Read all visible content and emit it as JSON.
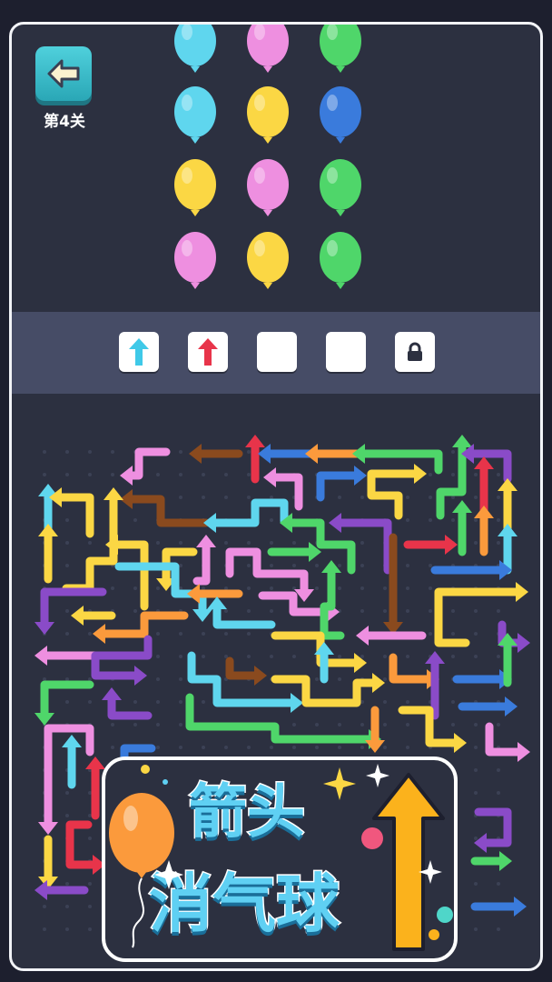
{
  "level": {
    "label": "第4关"
  },
  "balloons": [
    [
      "cyan",
      "pink",
      "green"
    ],
    [
      "cyan",
      "yellow",
      "blue"
    ],
    [
      "yellow",
      "pink",
      "green"
    ],
    [
      "pink",
      "yellow",
      "green"
    ]
  ],
  "balloon_colors": {
    "cyan": "#5fd6ee",
    "pink": "#ee8fe0",
    "green": "#4fd66a",
    "yellow": "#fbd744",
    "blue": "#3a7bdc"
  },
  "tray": {
    "slots": [
      {
        "state": "arrow",
        "color": "#3fc9e8"
      },
      {
        "state": "arrow",
        "color": "#e8344a"
      },
      {
        "state": "empty"
      },
      {
        "state": "empty"
      },
      {
        "state": "locked",
        "icon": "lock-icon"
      }
    ]
  },
  "banner": {
    "line1": "箭头",
    "line2": "消气球"
  },
  "colors": {
    "background": "#1d1f2e",
    "panel": "#2c3040",
    "tray": "#464c66",
    "banner_text": "#5fd0f3",
    "big_arrow": "#fbb21c"
  }
}
